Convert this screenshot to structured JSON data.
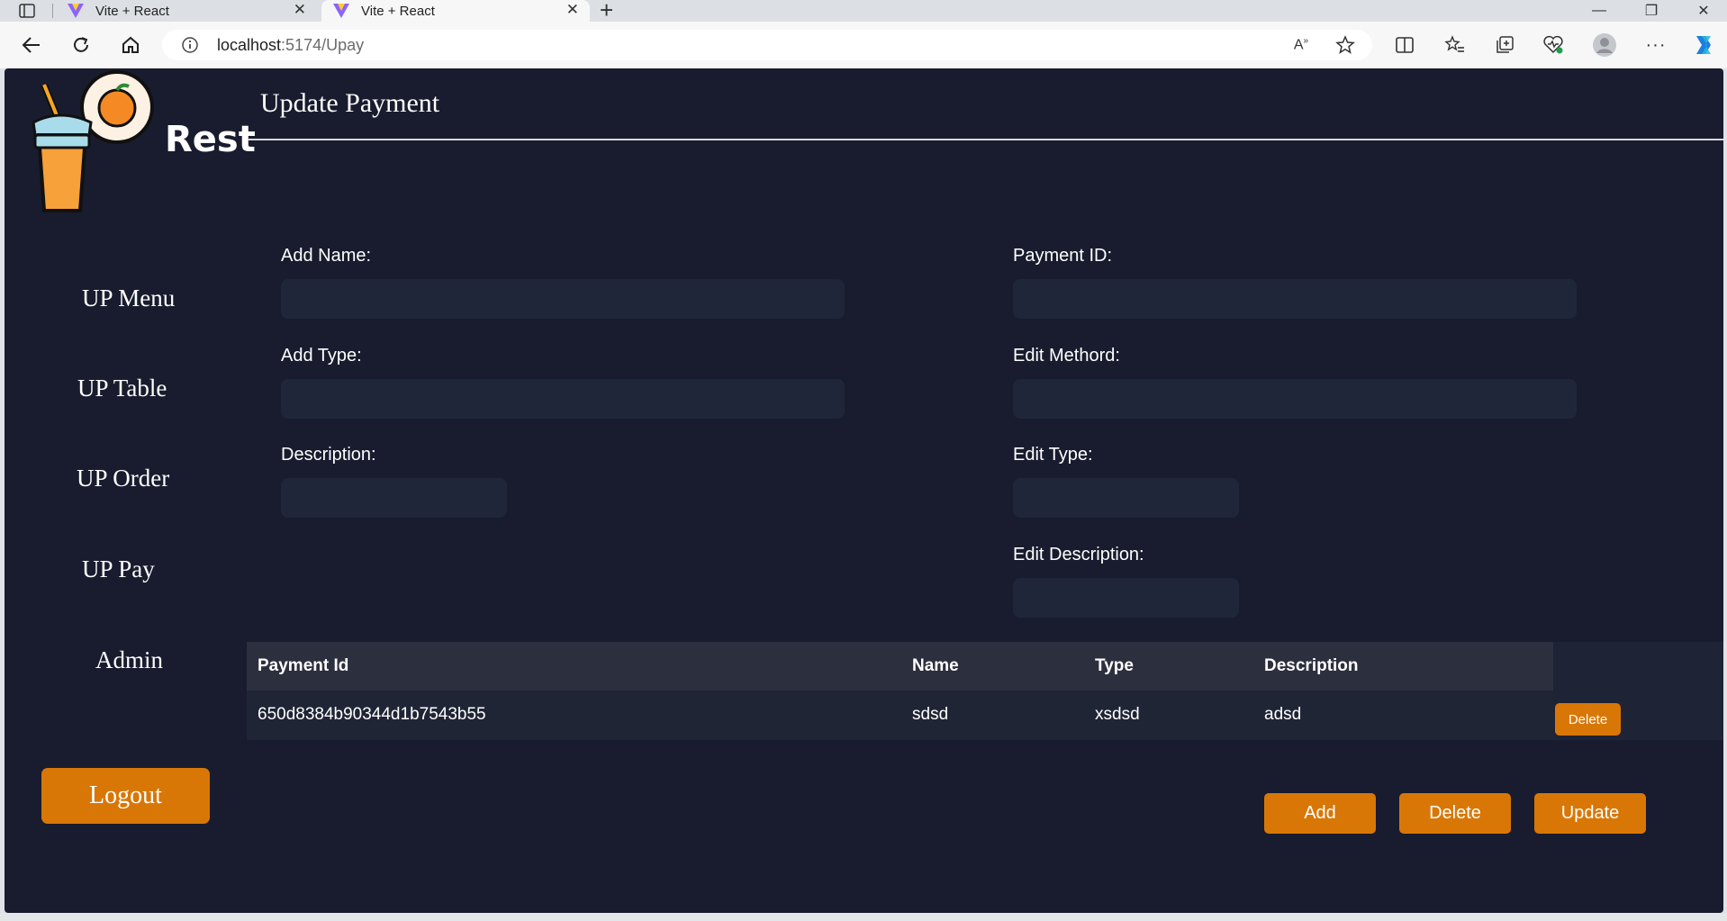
{
  "browser": {
    "tabs": [
      {
        "label": "Vite + React",
        "active": false
      },
      {
        "label": "Vite + React",
        "active": true
      }
    ],
    "url_host": "localhost",
    "url_path": ":5174/Upay",
    "icons": [
      "tab-actions-icon",
      "vite-icon",
      "close-icon",
      "plus-icon",
      "minimize-icon",
      "restore-icon",
      "window-close-icon",
      "back-icon",
      "refresh-icon",
      "home-icon",
      "info-icon",
      "read-aloud-icon",
      "favorite-star-icon",
      "split-screen-icon",
      "favorites-icon",
      "collections-icon",
      "browser-essentials-icon",
      "profile-icon",
      "more-icon",
      "copilot-icon"
    ]
  },
  "app": {
    "brand": "Rest",
    "page_title": "Update Payment",
    "sidebar": {
      "items": [
        {
          "label": "UP Menu"
        },
        {
          "label": "UP Table"
        },
        {
          "label": "UP Order"
        },
        {
          "label": "UP Pay"
        },
        {
          "label": "Admin"
        }
      ],
      "logout_label": "Logout"
    },
    "form": {
      "add_name": {
        "label": "Add Name:",
        "value": ""
      },
      "payment_id": {
        "label": "Payment ID:",
        "value": ""
      },
      "add_type": {
        "label": "Add Type:",
        "value": ""
      },
      "edit_method": {
        "label": "Edit Methord:",
        "value": ""
      },
      "description": {
        "label": "Description:",
        "value": ""
      },
      "edit_type": {
        "label": "Edit Type:",
        "value": ""
      },
      "edit_description": {
        "label": "Edit Description:",
        "value": ""
      }
    },
    "table": {
      "columns": [
        "Payment Id",
        "Name",
        "Type",
        "Description"
      ],
      "rows": [
        {
          "payment_id": "650d8384b90344d1b7543b55",
          "name": "sdsd",
          "type": "xsdsd",
          "description": "adsd",
          "delete_label": "Delete"
        }
      ]
    },
    "actions": {
      "add": "Add",
      "delete": "Delete",
      "update": "Update"
    },
    "colors": {
      "background": "#181c2e",
      "accent": "#d97706",
      "input": "#20263a",
      "table_header": "#2c2f3e"
    }
  }
}
